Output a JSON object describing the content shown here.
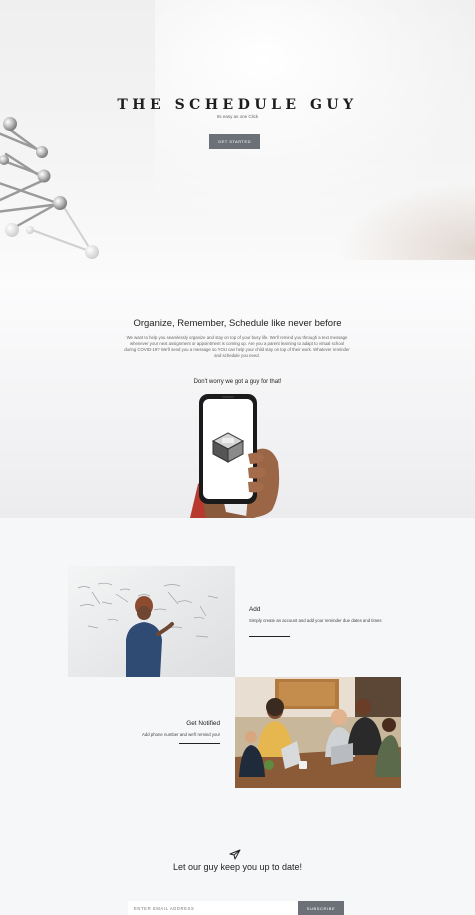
{
  "hero": {
    "title": "THE SCHEDULE GUY",
    "subtitle": "Its easy as one Click",
    "cta_label": "GET STARTED"
  },
  "about": {
    "heading": "Organize, Remember, Schedule like never before",
    "description": "We want to help you seamlessly organize and stay on top of your busy life. We'll remind you through a text message whenever your next assignment or appointment is coming up. Are you a parent learning to adapt to virtual school during COVID-19? We'll send you a message so YOU can help your child stay on top of their work. Whatever reminder and schedule you need.",
    "tagline": "Don't worry we got a guy for that!"
  },
  "features": [
    {
      "title": "Add",
      "description": "Simply create an account and add your reminder due dates and times"
    },
    {
      "title": "Get Notified",
      "description": "Add phone number and we'll remind you!"
    }
  ],
  "newsletter": {
    "heading": "Let our guy keep you up to date!",
    "email_placeholder": "ENTER EMAIL ADDRESS",
    "subscribe_label": "SUBSCRIBE"
  },
  "colors": {
    "button": "#6c7178",
    "background": "#f6f7f9",
    "text": "#222222"
  }
}
